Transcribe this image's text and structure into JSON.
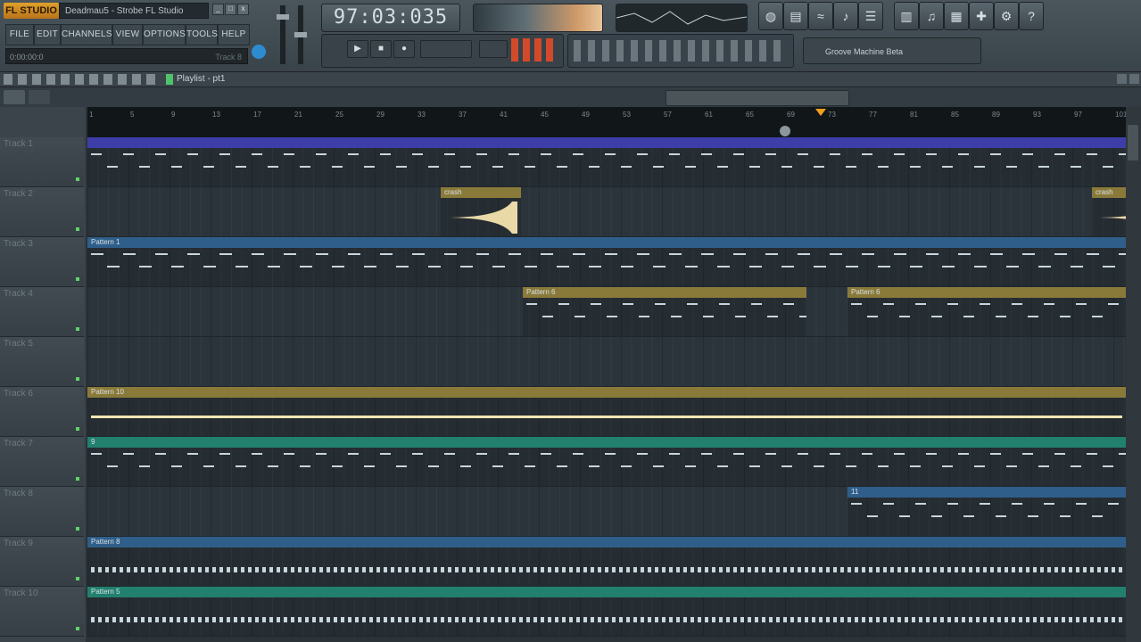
{
  "app": {
    "logo_text": "FL STUDIO",
    "window_title": "Deadmau5 - Strobe FL Studio",
    "win_buttons": [
      "_",
      "□",
      "x"
    ]
  },
  "menu": [
    "FILE",
    "EDIT",
    "CHANNELS",
    "VIEW",
    "OPTIONS",
    "TOOLS",
    "HELP"
  ],
  "hint_bar": {
    "text": "0:00:00:0",
    "right": "Track 8"
  },
  "transport": {
    "time": "97:03:035"
  },
  "toolbar_icons": [
    "globe-icon",
    "disk-icon",
    "wave-icon",
    "channel-icon",
    "mixer-icon",
    "piano-icon",
    "keys-icon",
    "browser-icon",
    "plugin-icon",
    "help-icon"
  ],
  "plugin_selector": {
    "label": "Groove Machine Beta"
  },
  "playlist": {
    "title": "Playlist - pt1"
  },
  "ruler_numbers": [
    "1",
    "5",
    "9",
    "13",
    "17",
    "21",
    "25",
    "29",
    "33",
    "37",
    "41",
    "45",
    "49",
    "53",
    "57",
    "61",
    "65",
    "69",
    "73",
    "77",
    "81",
    "85",
    "89",
    "93",
    "97",
    "101"
  ],
  "tracks": [
    {
      "name": "Track 1",
      "clips": [
        {
          "start": 0,
          "end": 1164,
          "color": "#3d3ea8",
          "label": ""
        }
      ]
    },
    {
      "name": "Track 2",
      "clips": [
        {
          "start": 396,
          "end": 486,
          "color": "#8a7a3a",
          "label": "crash"
        },
        {
          "start": 1126,
          "end": 1164,
          "color": "#8a7a3a",
          "label": "crash"
        }
      ]
    },
    {
      "name": "Track 3",
      "clips": [
        {
          "start": 0,
          "end": 1164,
          "color": "#2f5e8a",
          "label": "Pattern 1"
        }
      ]
    },
    {
      "name": "Track 4",
      "clips": [
        {
          "start": 488,
          "end": 806,
          "color": "#8a7a3a",
          "label": "Pattern 6"
        },
        {
          "start": 852,
          "end": 1164,
          "color": "#8a7a3a",
          "label": "Pattern 6"
        }
      ]
    },
    {
      "name": "Track 5",
      "clips": []
    },
    {
      "name": "Track 6",
      "clips": [
        {
          "start": 0,
          "end": 1164,
          "color": "#8a7a3a",
          "label": "Pattern 10"
        }
      ]
    },
    {
      "name": "Track 7",
      "clips": [
        {
          "start": 0,
          "end": 1164,
          "color": "#22806e",
          "label": "9"
        }
      ]
    },
    {
      "name": "Track 8",
      "clips": [
        {
          "start": 852,
          "end": 1164,
          "color": "#2f5e8a",
          "label": "11"
        }
      ]
    },
    {
      "name": "Track 9",
      "clips": [
        {
          "start": 0,
          "end": 1164,
          "color": "#2f5e8a",
          "label": "Pattern 8"
        }
      ]
    },
    {
      "name": "Track 10",
      "clips": [
        {
          "start": 0,
          "end": 1164,
          "color": "#22806e",
          "label": "Pattern 5"
        }
      ]
    }
  ]
}
